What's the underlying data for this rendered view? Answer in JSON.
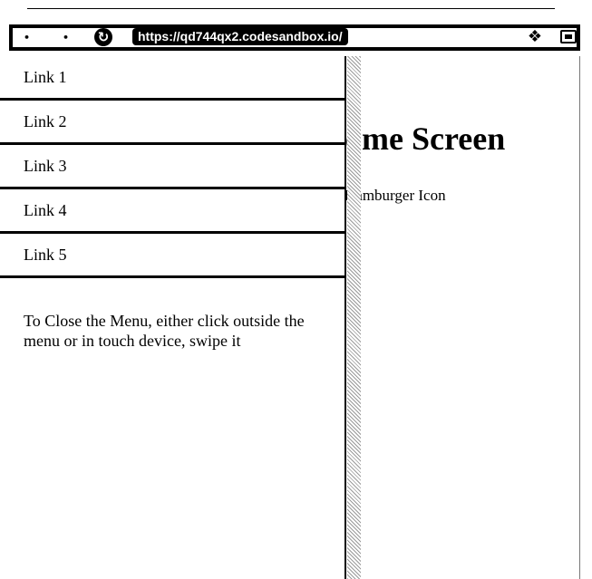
{
  "browser": {
    "back_glyph": "•",
    "forward_glyph": "•",
    "reload_glyph": "↻",
    "url": "https://qd744qx2.codesandbox.io/",
    "extension_glyph": "❖"
  },
  "page": {
    "title": "ome Screen",
    "subtitle": "Hamburger Icon"
  },
  "drawer": {
    "items": [
      {
        "label": "Link 1"
      },
      {
        "label": "Link 2"
      },
      {
        "label": "Link 3"
      },
      {
        "label": "Link 4"
      },
      {
        "label": "Link 5"
      }
    ],
    "hint": "To Close the Menu, either click outside the menu or in touch device, swipe it"
  }
}
